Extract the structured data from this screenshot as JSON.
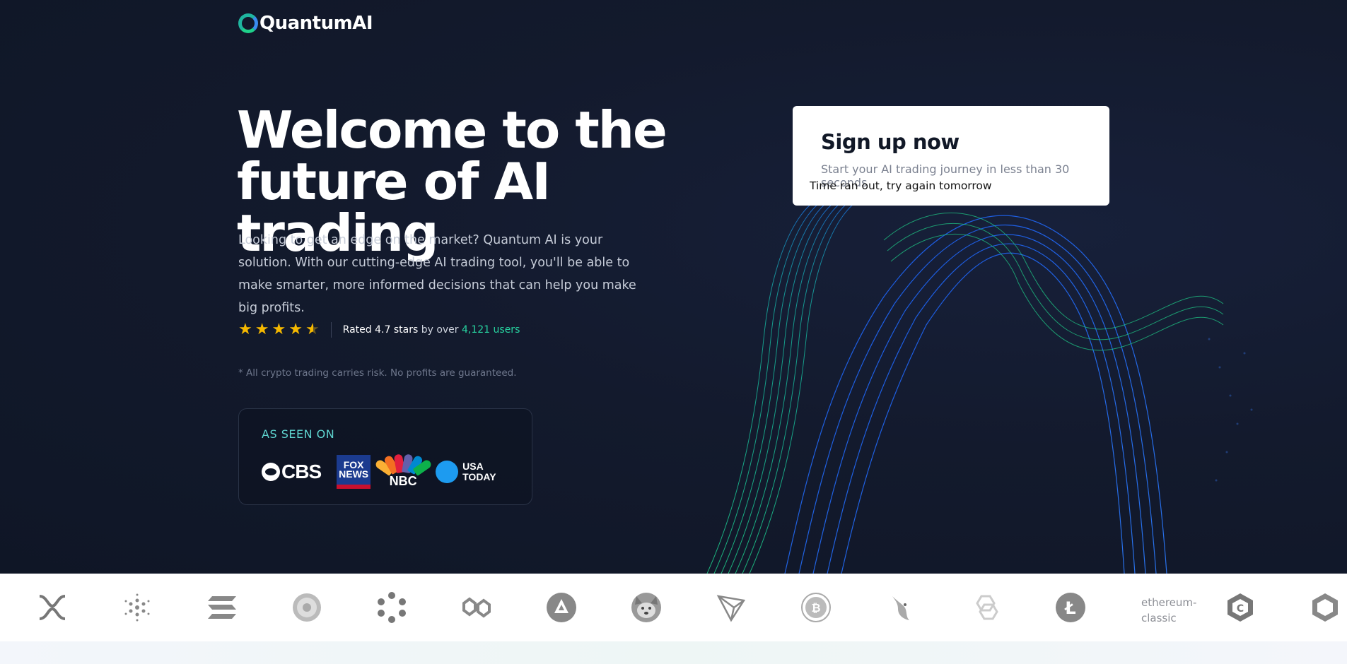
{
  "brand": {
    "name": "QuantumAI"
  },
  "hero": {
    "headline_line1": "Welcome to the",
    "headline_line2": "future of AI trading",
    "description": "Looking to get an edge on the market? Quantum AI is your solution. With our cutting-edge AI trading tool, you'll be able to make smarter, more informed decisions that can help you make big profits.",
    "rating": {
      "stars": 4.5,
      "prefix": "Rated 4.7 stars",
      "middle": "by over",
      "users": "4,121 users"
    },
    "disclaimer": "* All crypto trading carries risk. No profits are guaranteed."
  },
  "as_seen_on": {
    "title": "AS SEEN ON",
    "brands": [
      "CBS",
      "FOX NEWS",
      "NBC",
      "USA TODAY"
    ]
  },
  "signup": {
    "title": "Sign up now",
    "subtitle": "Start your AI trading journey in less than 30 seconds",
    "message": "Time ran out, try again tomorrow"
  },
  "coins": {
    "icons": [
      "xrp-icon",
      "cardano-icon",
      "solana-icon",
      "dogecoin-icon",
      "polkadot-icon",
      "polygon-icon",
      "avalanche-icon",
      "shiba-inu-icon",
      "tron-icon",
      "bitcoin-icon",
      "uniswap-icon",
      "chainlink-icon",
      "litecoin-icon",
      "ethereum-classic-icon",
      "cronos-icon",
      "hexagon-coin-icon"
    ],
    "ethereum_classic_label": "ethereum-classic"
  },
  "colors": {
    "accent": "#27d3a0",
    "star": "#f5b800",
    "background": "#131a2d"
  }
}
